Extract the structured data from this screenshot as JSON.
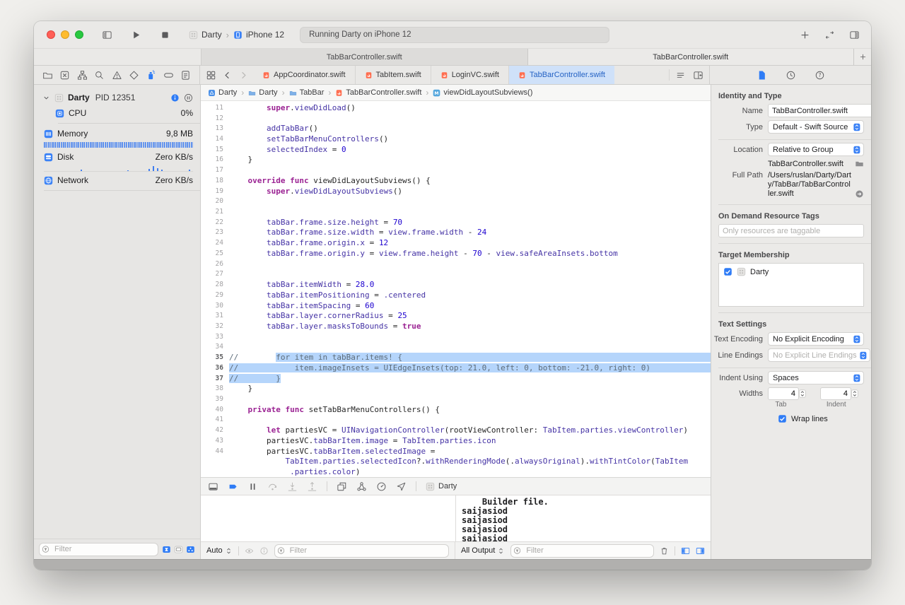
{
  "titlebar": {
    "scheme_project": "Darty",
    "scheme_device": "iPhone 12",
    "status_text": "Running Darty on iPhone 12"
  },
  "window_tabs": [
    {
      "label": "TabBarController.swift",
      "active": false
    },
    {
      "label": "TabBarController.swift",
      "active": true
    }
  ],
  "navigator": {
    "process_name": "Darty",
    "process_pid": "PID 12351",
    "cpu_label": "CPU",
    "cpu_value": "0%",
    "memory_label": "Memory",
    "memory_value": "9,8 MB",
    "disk_label": "Disk",
    "disk_value": "Zero KB/s",
    "network_label": "Network",
    "network_value": "Zero KB/s",
    "filter_placeholder": "Filter"
  },
  "editor": {
    "tabs": [
      {
        "label": "AppCoordinator.swift",
        "active": false
      },
      {
        "label": "TabItem.swift",
        "active": false
      },
      {
        "label": "LoginVC.swift",
        "active": false
      },
      {
        "label": "TabBarController.swift",
        "active": true
      }
    ],
    "breadcrumbs": [
      {
        "label": "Darty",
        "icon": "proj"
      },
      {
        "label": "Darty",
        "icon": "folder"
      },
      {
        "label": "TabBar",
        "icon": "folder"
      },
      {
        "label": "TabBarController.swift",
        "icon": "swift"
      },
      {
        "label": "viewDidLayoutSubviews()",
        "icon": "method"
      }
    ],
    "code_lines": [
      {
        "n": "11",
        "t": [
          [
            "pl",
            "        "
          ],
          [
            "kw",
            "super"
          ],
          [
            "pl",
            "."
          ],
          [
            "id",
            "viewDidLoad"
          ],
          [
            "pl",
            "()"
          ]
        ]
      },
      {
        "n": "12",
        "t": []
      },
      {
        "n": "13",
        "t": [
          [
            "pl",
            "        "
          ],
          [
            "id",
            "addTabBar"
          ],
          [
            "pl",
            "()"
          ]
        ]
      },
      {
        "n": "14",
        "t": [
          [
            "pl",
            "        "
          ],
          [
            "id",
            "setTabBarMenuControllers"
          ],
          [
            "pl",
            "()"
          ]
        ]
      },
      {
        "n": "15",
        "t": [
          [
            "pl",
            "        "
          ],
          [
            "id",
            "selectedIndex"
          ],
          [
            "pl",
            " = "
          ],
          [
            "nu",
            "0"
          ]
        ]
      },
      {
        "n": "16",
        "t": [
          [
            "pl",
            "    }"
          ]
        ]
      },
      {
        "n": "17",
        "t": []
      },
      {
        "n": "18",
        "t": [
          [
            "pl",
            "    "
          ],
          [
            "kw",
            "override"
          ],
          [
            "pl",
            " "
          ],
          [
            "kw",
            "func"
          ],
          [
            "pl",
            " viewDidLayoutSubviews() {"
          ]
        ]
      },
      {
        "n": "19",
        "t": [
          [
            "pl",
            "        "
          ],
          [
            "kw",
            "super"
          ],
          [
            "pl",
            "."
          ],
          [
            "id",
            "viewDidLayoutSubviews"
          ],
          [
            "pl",
            "()"
          ]
        ]
      },
      {
        "n": "20",
        "t": []
      },
      {
        "n": "21",
        "t": []
      },
      {
        "n": "22",
        "t": [
          [
            "pl",
            "        "
          ],
          [
            "id",
            "tabBar.frame.size.height"
          ],
          [
            "pl",
            " = "
          ],
          [
            "nu",
            "70"
          ]
        ]
      },
      {
        "n": "23",
        "t": [
          [
            "pl",
            "        "
          ],
          [
            "id",
            "tabBar.frame.size.width"
          ],
          [
            "pl",
            " = "
          ],
          [
            "id",
            "view.frame.width"
          ],
          [
            "pl",
            " - "
          ],
          [
            "nu",
            "24"
          ]
        ]
      },
      {
        "n": "24",
        "t": [
          [
            "pl",
            "        "
          ],
          [
            "id",
            "tabBar.frame.origin.x"
          ],
          [
            "pl",
            " = "
          ],
          [
            "nu",
            "12"
          ]
        ]
      },
      {
        "n": "25",
        "t": [
          [
            "pl",
            "        "
          ],
          [
            "id",
            "tabBar.frame.origin.y"
          ],
          [
            "pl",
            " = "
          ],
          [
            "id",
            "view.frame.height"
          ],
          [
            "pl",
            " - "
          ],
          [
            "nu",
            "70"
          ],
          [
            "pl",
            " - "
          ],
          [
            "id",
            "view.safeAreaInsets.bottom"
          ]
        ]
      },
      {
        "n": "26",
        "t": []
      },
      {
        "n": "27",
        "t": []
      },
      {
        "n": "28",
        "t": [
          [
            "pl",
            "        "
          ],
          [
            "id",
            "tabBar.itemWidth"
          ],
          [
            "pl",
            " = "
          ],
          [
            "nu",
            "28.0"
          ]
        ]
      },
      {
        "n": "29",
        "t": [
          [
            "pl",
            "        "
          ],
          [
            "id",
            "tabBar.itemPositioning"
          ],
          [
            "pl",
            " = "
          ],
          [
            "id",
            ".centered"
          ]
        ]
      },
      {
        "n": "30",
        "t": [
          [
            "pl",
            "        "
          ],
          [
            "id",
            "tabBar.itemSpacing"
          ],
          [
            "pl",
            " = "
          ],
          [
            "nu",
            "60"
          ]
        ]
      },
      {
        "n": "31",
        "t": [
          [
            "pl",
            "        "
          ],
          [
            "id",
            "tabBar.layer.cornerRadius"
          ],
          [
            "pl",
            " = "
          ],
          [
            "nu",
            "25"
          ]
        ]
      },
      {
        "n": "32",
        "t": [
          [
            "pl",
            "        "
          ],
          [
            "id",
            "tabBar.layer.masksToBounds"
          ],
          [
            "pl",
            " = "
          ],
          [
            "kw",
            "true"
          ]
        ]
      },
      {
        "n": "33",
        "t": []
      },
      {
        "n": "34",
        "t": []
      },
      {
        "n": "35",
        "sel": true,
        "ext": true,
        "t": [
          [
            "cm",
            "//        "
          ],
          [
            "cmh",
            "for item in tabBar.items! {"
          ]
        ]
      },
      {
        "n": "36",
        "sel": true,
        "ext": true,
        "t": [
          [
            "cmh",
            "//            item.imageInsets = UIEdgeInsets(top: 21.0, left: 0, bottom: -21.0, right: 0)"
          ]
        ]
      },
      {
        "n": "37",
        "sel": true,
        "t": [
          [
            "cmh",
            "//        }"
          ]
        ]
      },
      {
        "n": "38",
        "t": [
          [
            "pl",
            "    }"
          ]
        ]
      },
      {
        "n": "39",
        "t": []
      },
      {
        "n": "40",
        "t": [
          [
            "pl",
            "    "
          ],
          [
            "kw",
            "private"
          ],
          [
            "pl",
            " "
          ],
          [
            "kw",
            "func"
          ],
          [
            "pl",
            " setTabBarMenuControllers() {"
          ]
        ]
      },
      {
        "n": "41",
        "t": []
      },
      {
        "n": "42",
        "t": [
          [
            "pl",
            "        "
          ],
          [
            "kw",
            "let"
          ],
          [
            "pl",
            " partiesVC = "
          ],
          [
            "id",
            "UINavigationController"
          ],
          [
            "pl",
            "(rootViewController: "
          ],
          [
            "id",
            "TabItem.parties.viewController"
          ],
          [
            "pl",
            ")"
          ]
        ]
      },
      {
        "n": "43",
        "t": [
          [
            "pl",
            "        partiesVC."
          ],
          [
            "id",
            "tabBarItem.image"
          ],
          [
            "pl",
            " = "
          ],
          [
            "id",
            "TabItem.parties.icon"
          ]
        ]
      },
      {
        "n": "44",
        "t": [
          [
            "pl",
            "        partiesVC."
          ],
          [
            "id",
            "tabBarItem.selectedImage"
          ],
          [
            "pl",
            " ="
          ]
        ]
      },
      {
        "n": "",
        "t": [
          [
            "pl",
            "            "
          ],
          [
            "id",
            "TabItem.parties.selectedIcon"
          ],
          [
            "pl",
            "?."
          ],
          [
            "id",
            "withRenderingMode"
          ],
          [
            "pl",
            "(."
          ],
          [
            "id",
            "alwaysOriginal"
          ],
          [
            "pl",
            ")."
          ],
          [
            "id",
            "withTintColor"
          ],
          [
            "pl",
            "("
          ],
          [
            "id",
            "TabItem"
          ]
        ]
      },
      {
        "n": "",
        "t": [
          [
            "pl",
            "             "
          ],
          [
            "id",
            ".parties.color"
          ],
          [
            "pl",
            ")"
          ]
        ]
      }
    ]
  },
  "debug": {
    "scheme_label": "Darty",
    "variables_scope": "Auto",
    "variables_filter_placeholder": "Filter",
    "console_lines": [
      "    Builder file.",
      "saijasiod",
      "saijasiod",
      "saijasiod",
      "saijasiod"
    ],
    "output_scope": "All Output",
    "console_filter_placeholder": "Filter"
  },
  "inspector": {
    "identity_header": "Identity and Type",
    "name_label": "Name",
    "name_value": "TabBarController.swift",
    "type_label": "Type",
    "type_value": "Default - Swift Source",
    "location_label": "Location",
    "location_value": "Relative to Group",
    "file_name": "TabBarController.swift",
    "full_path_label": "Full Path",
    "full_path_value": "/Users/ruslan/Darty/Darty/TabBar/TabBarController.swift",
    "odr_header": "On Demand Resource Tags",
    "odr_placeholder": "Only resources are taggable",
    "target_header": "Target Membership",
    "target_name": "Darty",
    "text_settings_header": "Text Settings",
    "encoding_label": "Text Encoding",
    "encoding_value": "No Explicit Encoding",
    "line_endings_label": "Line Endings",
    "line_endings_value": "No Explicit Line Endings",
    "indent_label": "Indent Using",
    "indent_value": "Spaces",
    "widths_label": "Widths",
    "tab_width": "4",
    "indent_width": "4",
    "tab_caption": "Tab",
    "indent_caption": "Indent",
    "wrap_label": "Wrap lines"
  }
}
